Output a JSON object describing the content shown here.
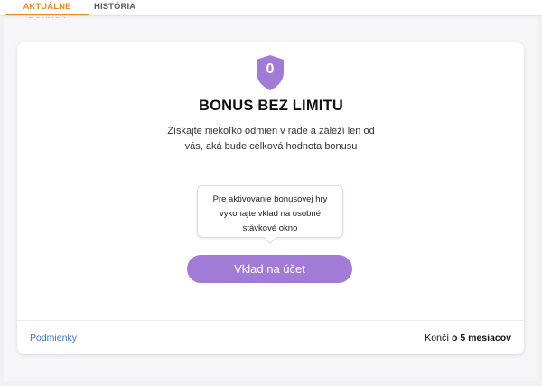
{
  "tabs": [
    {
      "label": "AKTUÁLNE BONUSY",
      "active": true
    },
    {
      "label": "HISTÓRIA",
      "active": false
    }
  ],
  "bonus": {
    "count": "0",
    "title": "BONUS BEZ LIMITU",
    "description": "Získajte niekoľko odmien v rade a záleží len od vás, aká bude celková hodnota bonusu",
    "tooltip": "Pre aktivovanie bonusovej hry vykonajte vklad na osobné stávkové okno",
    "deposit_label": "Vklad na účet"
  },
  "footer": {
    "terms_label": "Podmienky",
    "ends_prefix": "Končí ",
    "ends_value": "o 5 mesiacov"
  },
  "colors": {
    "accent_orange": "#f18a1c",
    "purple": "#a27bd6",
    "link_blue": "#3a72c8"
  },
  "icons": [
    "shield-icon"
  ]
}
